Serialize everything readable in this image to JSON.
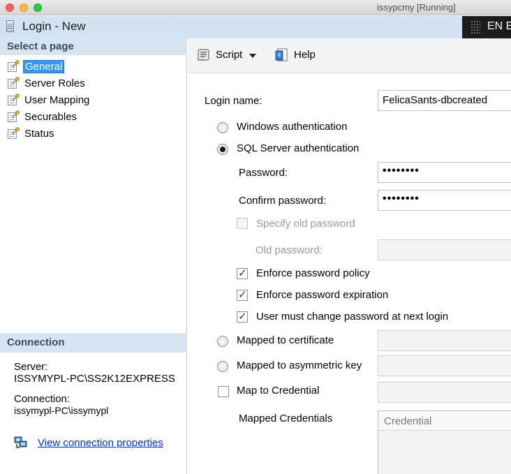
{
  "mac": {
    "title": "issypcmy [Running]"
  },
  "dialog": {
    "title": "Login - New",
    "lang": "EN E"
  },
  "left": {
    "select_header": "Select a page",
    "pages": [
      {
        "label": "General",
        "selected": true
      },
      {
        "label": "Server Roles"
      },
      {
        "label": "User Mapping"
      },
      {
        "label": "Securables"
      },
      {
        "label": "Status"
      }
    ],
    "connection_header": "Connection",
    "server_label": "Server:",
    "server_value": "ISSYMYPL-PC\\SS2K12EXPRESS",
    "connection_label": "Connection:",
    "connection_value": "issymypl-PC\\issymypl",
    "view_link": "View connection properties"
  },
  "toolbar": {
    "script_label": "Script",
    "help_label": "Help"
  },
  "form": {
    "login_name_label": "Login name:",
    "login_name_value": "FelicaSants-dbcreated",
    "windows_auth": "Windows authentication",
    "sql_auth": "SQL Server authentication",
    "password_label": "Password:",
    "password_value": "••••••••",
    "confirm_label": "Confirm password:",
    "confirm_value": "••••••••",
    "specify_old": "Specify old password",
    "old_password_label": "Old password:",
    "enforce_policy": "Enforce password policy",
    "enforce_expiration": "Enforce password expiration",
    "must_change": "User must change password at next login",
    "mapped_cert": "Mapped to certificate",
    "mapped_asym": "Mapped to asymmetric key",
    "map_credential": "Map to Credential",
    "mapped_credentials": "Mapped Credentials",
    "credential_col": "Credential"
  },
  "colors": {
    "selection": "#3399ff",
    "header_bg": "#d7e4f2",
    "link": "#0033cc"
  }
}
